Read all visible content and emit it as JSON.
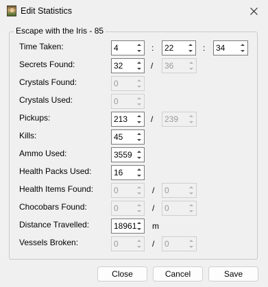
{
  "window": {
    "title": "Edit Statistics"
  },
  "group": {
    "title": "Escape with the Iris - 85"
  },
  "time": {
    "label": "Time Taken:",
    "hours": "4",
    "minutes": "22",
    "seconds": "34",
    "separator": ":"
  },
  "rows": {
    "secrets": {
      "label": "Secrets Found:",
      "value": "32",
      "slash": "/",
      "total": "36"
    },
    "crystals_found": {
      "label": "Crystals Found:",
      "value": "0"
    },
    "crystals_used": {
      "label": "Crystals Used:",
      "value": "0"
    },
    "pickups": {
      "label": "Pickups:",
      "value": "213",
      "slash": "/",
      "total": "239"
    },
    "kills": {
      "label": "Kills:",
      "value": "45"
    },
    "ammo": {
      "label": "Ammo Used:",
      "value": "3559"
    },
    "health_packs": {
      "label": "Health Packs Used:",
      "value": "16"
    },
    "health_items": {
      "label": "Health Items Found:",
      "value": "0",
      "slash": "/",
      "total": "0"
    },
    "chocobars": {
      "label": "Chocobars Found:",
      "value": "0",
      "slash": "/",
      "total": "0"
    },
    "distance": {
      "label": "Distance Travelled:",
      "value": "18961",
      "unit": "m"
    },
    "vessels": {
      "label": "Vessels Broken:",
      "value": "0",
      "slash": "/",
      "total": "0"
    }
  },
  "buttons": {
    "close": "Close",
    "cancel": "Cancel",
    "save": "Save"
  }
}
